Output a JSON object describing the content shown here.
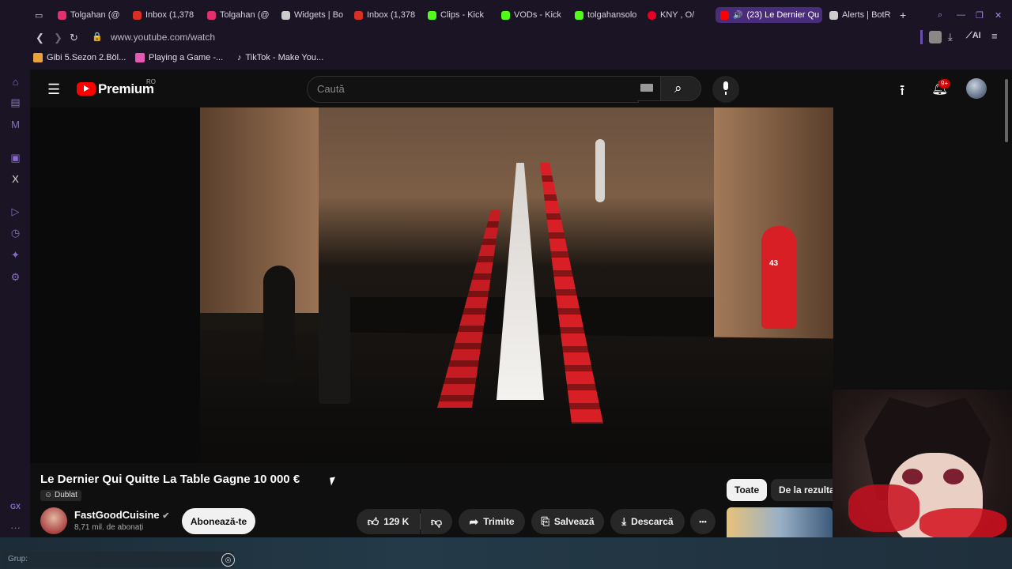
{
  "browser": {
    "tabs": [
      {
        "label": "Tolgahan (@",
        "color": "#e1306c"
      },
      {
        "label": "Inbox (1,378",
        "color": "#d93025"
      },
      {
        "label": "Tolgahan (@",
        "color": "#e1306c"
      },
      {
        "label": "Widgets | Bo",
        "color": "#cccccc"
      },
      {
        "label": "Inbox (1,378",
        "color": "#d93025"
      },
      {
        "label": "Clips - Kick",
        "color": "#53fc18"
      },
      {
        "label": "VODs - Kick",
        "color": "#53fc18"
      },
      {
        "label": "tolgahansolo",
        "color": "#53fc18"
      },
      {
        "label": "KNY , O/",
        "color": "#e60023"
      },
      {
        "label": "(23) Le Dernier Qu",
        "color": "#ff0000"
      },
      {
        "label": "Alerts | BotR",
        "color": "#cccccc"
      }
    ],
    "new_tab": "+",
    "url": "www.youtube.com/watch",
    "ai_label": "AI",
    "bookmarks": [
      {
        "label": "Gibi 5.Sezon 2.Böl...",
        "color": "#e8a33a"
      },
      {
        "label": "Playing a Game -...",
        "color": "#e35ab3"
      },
      {
        "label": "TikTok - Make You...",
        "color": "#ffffff"
      }
    ],
    "sidebar_gx": "GX",
    "sidebar_more": "···"
  },
  "youtube": {
    "logo_text": "Premium",
    "region": "RO",
    "search_placeholder": "Caută",
    "notif_count": "9+",
    "video_title": "Le Dernier Qui Quitte La Table Gagne 10 000 €",
    "dub_label": "Dublat",
    "channel_name": "FastGoodCuisine",
    "subscribers": "8,71 mil. de abonați",
    "subscribe_label": "Abonează-te",
    "likes": "129 K",
    "share_label": "Trimite",
    "save_label": "Salvează",
    "download_label": "Descarcă",
    "more_label": "•••",
    "filters": [
      {
        "label": "Toate",
        "active": true
      },
      {
        "label": "De la rezultat",
        "active": false
      }
    ]
  },
  "taskbar": {
    "group_label": "Grup:"
  },
  "colors": {
    "accent_browser": "#8a6cd0",
    "yt_red": "#ff0000",
    "jersey_red": "#d81f26"
  }
}
